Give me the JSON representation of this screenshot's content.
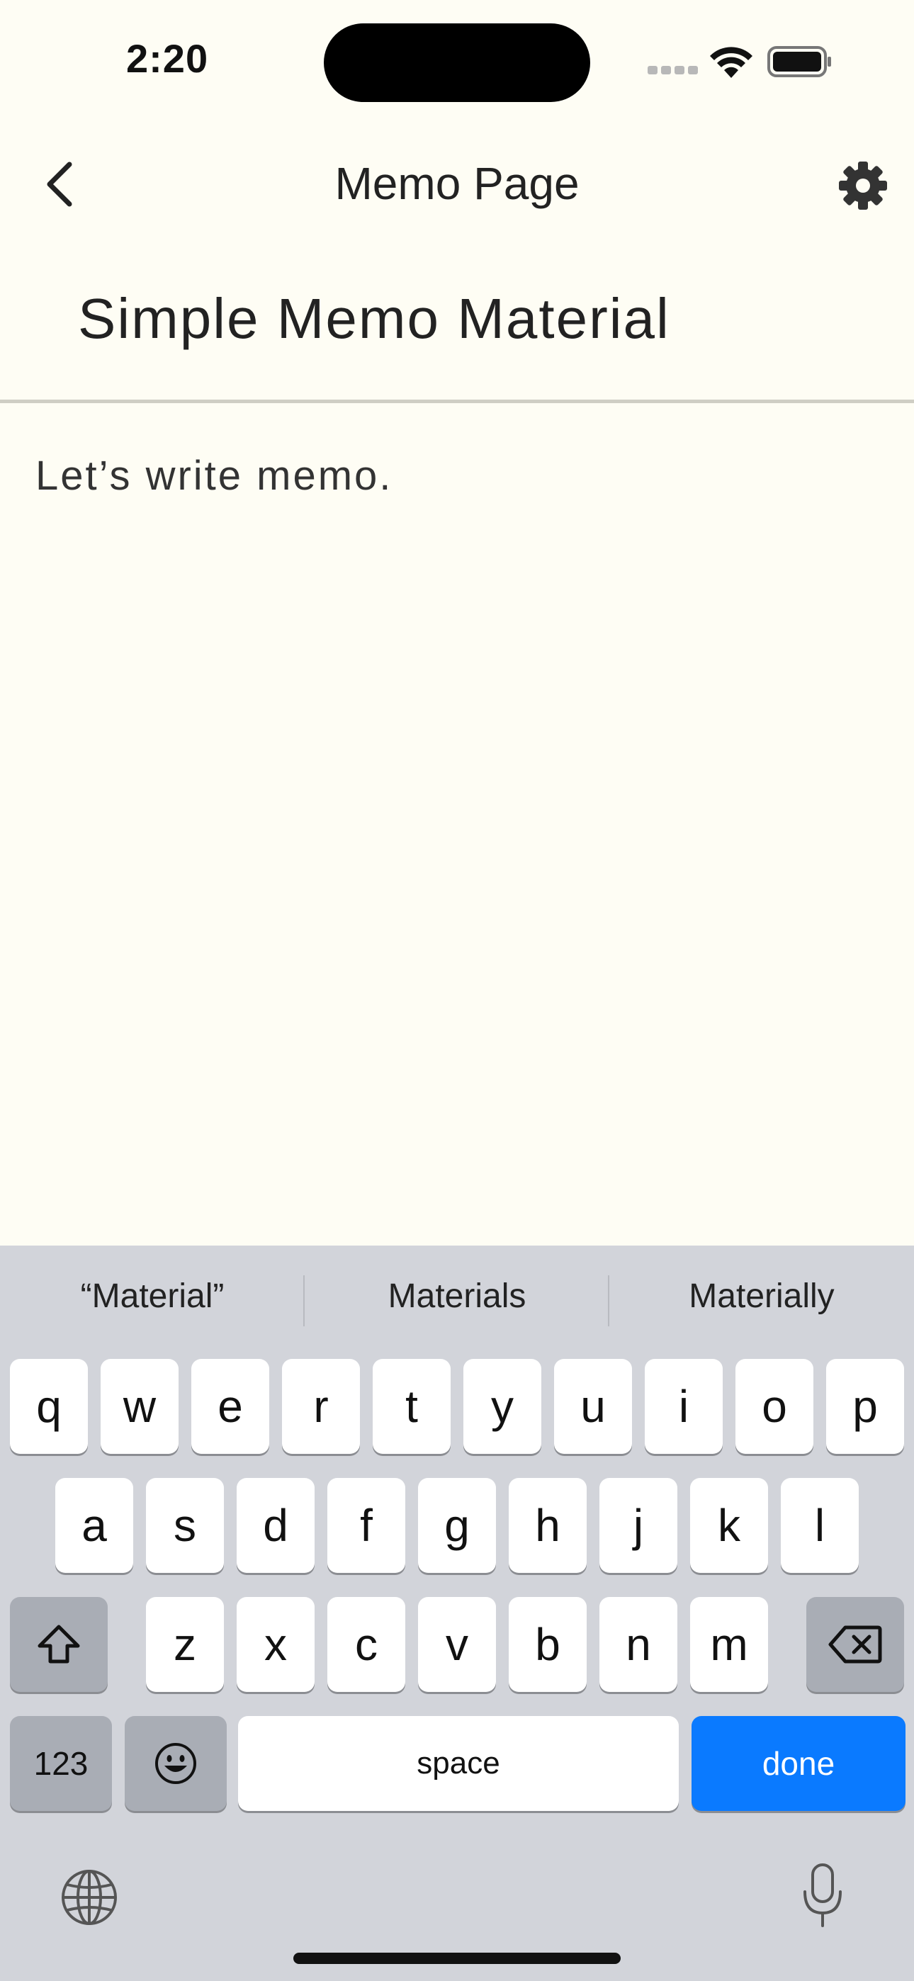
{
  "status_bar": {
    "time": "2:20",
    "icons": [
      "cellular-signal-icon",
      "wifi-icon",
      "battery-icon"
    ]
  },
  "nav": {
    "back_icon": "chevron-left-icon",
    "title": "Memo Page",
    "settings_icon": "gear-icon"
  },
  "memo": {
    "title": "Simple Memo Material",
    "body": "Let’s write memo."
  },
  "keyboard": {
    "suggestions": [
      "“Material”",
      "Materials",
      "Materially"
    ],
    "row1": [
      "q",
      "w",
      "e",
      "r",
      "t",
      "y",
      "u",
      "i",
      "o",
      "p"
    ],
    "row2": [
      "a",
      "s",
      "d",
      "f",
      "g",
      "h",
      "j",
      "k",
      "l"
    ],
    "row3": [
      "z",
      "x",
      "c",
      "v",
      "b",
      "n",
      "m"
    ],
    "numbers_label": "123",
    "space_label": "space",
    "done_label": "done",
    "icons": [
      "shift-icon",
      "delete-icon",
      "emoji-icon",
      "globe-icon",
      "microphone-icon"
    ]
  },
  "colors": {
    "background": "#fefdf4",
    "keyboard_bg": "#d2d4da",
    "done_key": "#0a7aff"
  }
}
